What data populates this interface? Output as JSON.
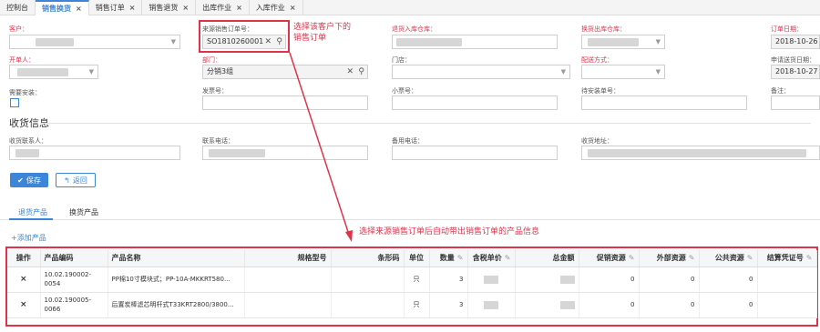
{
  "tabs": [
    {
      "label": "控制台",
      "active": false,
      "closable": false
    },
    {
      "label": "销售换货",
      "active": true,
      "closable": true
    },
    {
      "label": "销售订单",
      "active": false,
      "closable": true
    },
    {
      "label": "销售退货",
      "active": false,
      "closable": true
    },
    {
      "label": "出库作业",
      "active": false,
      "closable": true
    },
    {
      "label": "入库作业",
      "active": false,
      "closable": true
    }
  ],
  "close_glyph": "×",
  "form": {
    "customer_label": "客户：",
    "source_order_label": "来源销售订单号：",
    "source_order_value": "SO1810260001",
    "return_wh_label": "退货入库仓库：",
    "exchange_wh_label": "换货出库仓库：",
    "order_date_label": "订单日期：",
    "order_date_value": "2018-10-26",
    "creator_label": "开单人：",
    "dept_label": "部门：",
    "dept_value": "分销3组",
    "store_label": "门店：",
    "delivery_label": "配送方式：",
    "ship_date_label": "申请送货日期：",
    "ship_date_value": "2018-10-27",
    "install_label": "需要安装：",
    "invoice_label": "发票号：",
    "ticket_label": "小票号：",
    "install_no_label": "待安装单号：",
    "remark_label": "备注："
  },
  "receive": {
    "title": "收货信息",
    "contact_label": "收货联系人：",
    "phone_label": "联系电话：",
    "backup_phone_label": "备用电话：",
    "address_label": "收货地址："
  },
  "buttons": {
    "save": "保存",
    "back": "返回"
  },
  "subtabs": [
    "退货产品",
    "换货产品"
  ],
  "add_product": "+添加产品",
  "annotations": {
    "pick_order": "选择该客户下的销售订单",
    "auto_fill": "选择来源销售订单后自动带出销售订单的产品信息"
  },
  "table": {
    "headers": [
      "操作",
      "产品编码",
      "产品名称",
      "规格型号",
      "条形码",
      "单位",
      "数量",
      "含税单价",
      "总金额",
      "促销资源",
      "外部资源",
      "公共资源",
      "结算凭证号"
    ],
    "rows": [
      {
        "op": "×",
        "code": "10.02.190002-0054",
        "name": "PP棉10寸模块式；PP-10A-MKKRT580...",
        "spec": "",
        "barcode": "",
        "unit": "只",
        "qty": "3",
        "promo": "0",
        "external": "0",
        "public": "0",
        "voucher": ""
      },
      {
        "op": "×",
        "code": "10.02.190005-0066",
        "name": "后置炭棒滤芯明杆式T33KRT2800/3800...",
        "spec": "",
        "barcode": "",
        "unit": "只",
        "qty": "3",
        "promo": "0",
        "external": "0",
        "public": "0",
        "voucher": ""
      }
    ]
  },
  "colors": {
    "accent": "#3b86d8",
    "annotation": "#e0334a"
  },
  "icons": [
    "close-icon",
    "search-icon",
    "chevron-down-icon",
    "check-icon",
    "back-arrow-icon",
    "edit-icon",
    "delete-icon"
  ]
}
